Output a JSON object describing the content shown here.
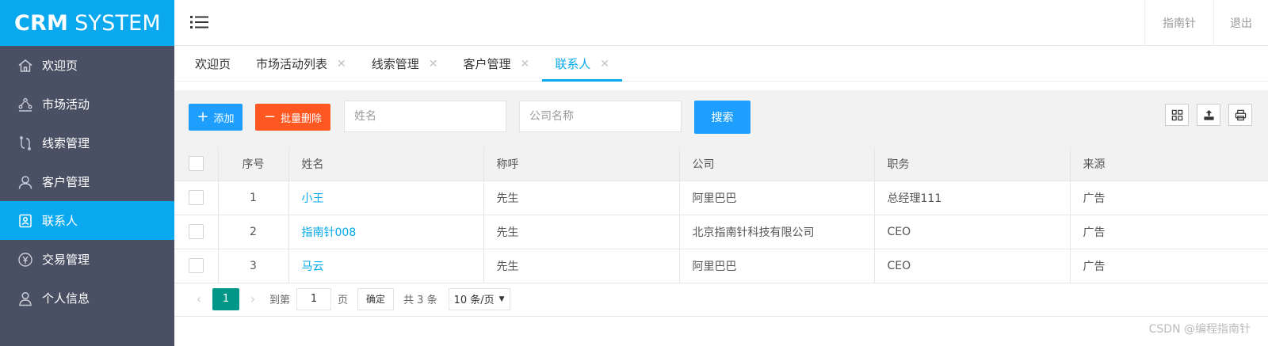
{
  "app": {
    "logo_bold": "CRM",
    "logo_rest": "SYSTEM"
  },
  "sidebar": {
    "items": [
      {
        "label": "欢迎页",
        "icon": "home-icon",
        "active": false
      },
      {
        "label": "市场活动",
        "icon": "activity-icon",
        "active": false
      },
      {
        "label": "线索管理",
        "icon": "clue-icon",
        "active": false
      },
      {
        "label": "客户管理",
        "icon": "user-icon",
        "active": false
      },
      {
        "label": "联系人",
        "icon": "contact-card-icon",
        "active": true
      },
      {
        "label": "交易管理",
        "icon": "yen-icon",
        "active": false
      },
      {
        "label": "个人信息",
        "icon": "person-icon",
        "active": false
      }
    ]
  },
  "header": {
    "menu_icon": "menu-icon",
    "user_label": "指南针",
    "logout_label": "退出"
  },
  "tabs": [
    {
      "label": "欢迎页",
      "closable": false,
      "active": false
    },
    {
      "label": "市场活动列表",
      "closable": true,
      "active": false
    },
    {
      "label": "线索管理",
      "closable": true,
      "active": false
    },
    {
      "label": "客户管理",
      "closable": true,
      "active": false
    },
    {
      "label": "联系人",
      "closable": true,
      "active": true
    }
  ],
  "toolbar": {
    "add_label": "添加",
    "delete_label": "批量删除",
    "name_placeholder": "姓名",
    "company_placeholder": "公司名称",
    "search_label": "搜索",
    "tool_icons": [
      "columns-icon",
      "export-icon",
      "print-icon"
    ]
  },
  "table": {
    "headers": [
      "序号",
      "姓名",
      "称呼",
      "公司",
      "职务",
      "来源"
    ],
    "rows": [
      [
        "1",
        "小王",
        "先生",
        "阿里巴巴",
        "总经理111",
        "广告"
      ],
      [
        "2",
        "指南针008",
        "先生",
        "北京指南针科技有限公司",
        "CEO",
        "广告"
      ],
      [
        "3",
        "马云",
        "先生",
        "阿里巴巴",
        "CEO",
        "广告"
      ]
    ]
  },
  "pager": {
    "current_page": "1",
    "goto_label": "到第",
    "goto_value": "1",
    "page_label": "页",
    "confirm_label": "确定",
    "total_label": "共 3 条",
    "per_page": "10 条/页"
  },
  "watermark": "CSDN @编程指南针"
}
